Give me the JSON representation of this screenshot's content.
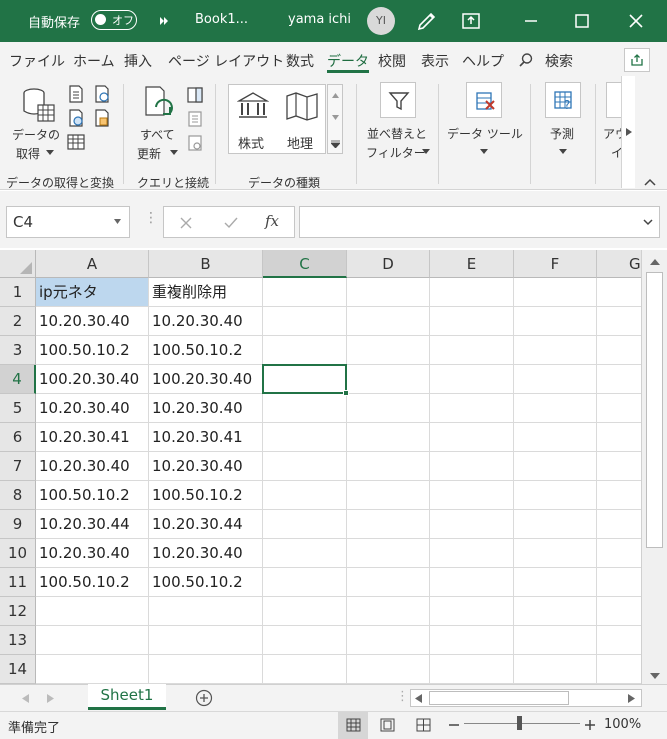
{
  "titlebar": {
    "autosave_label": "自動保存",
    "autosave_state": "オフ",
    "workbook": "Book1...",
    "user_name": "yama ichi",
    "user_initials": "YI"
  },
  "tabs": [
    "ファイル",
    "ホーム",
    "挿入",
    "ページ レイアウト",
    "数式",
    "データ",
    "校閲",
    "表示",
    "ヘルプ",
    "検索"
  ],
  "active_tab": "データ",
  "ribbon": {
    "get_data_line1": "データの",
    "get_data_line2": "取得",
    "refresh_line1": "すべて",
    "refresh_line2": "更新",
    "stocks": "株式",
    "geography": "地理",
    "sort_line1": "並べ替えと",
    "sort_line2": "フィルター",
    "data_tools": "データ ツール",
    "forecast": "予測",
    "outline_line1": "アウ",
    "outline_line2": "イ",
    "group_get_transform": "データの取得と変換",
    "group_queries": "クエリと接続",
    "group_data_types": "データの種類"
  },
  "formula_bar": {
    "name_box": "C4",
    "fx": "fx",
    "formula": ""
  },
  "grid": {
    "columns": [
      "A",
      "B",
      "C",
      "D",
      "E",
      "F",
      "G"
    ],
    "rows": [
      "1",
      "2",
      "3",
      "4",
      "5",
      "6",
      "7",
      "8",
      "9",
      "10",
      "11",
      "12",
      "13",
      "14"
    ],
    "col_a": [
      "ip元ネタ",
      "10.20.30.40",
      "100.50.10.2",
      "100.20.30.40",
      "10.20.30.40",
      "10.20.30.41",
      "10.20.30.40",
      "100.50.10.2",
      "10.20.30.44",
      "10.20.30.40",
      "100.50.10.2"
    ],
    "col_b": [
      "重複削除用",
      "10.20.30.40",
      "100.50.10.2",
      "100.20.30.40",
      "10.20.30.40",
      "10.20.30.41",
      "10.20.30.40",
      "100.50.10.2",
      "10.20.30.44",
      "10.20.30.40",
      "100.50.10.2"
    ],
    "active_cell": "C4"
  },
  "sheet_tab": "Sheet1",
  "status": {
    "ready": "準備完了",
    "zoom": "100%"
  },
  "colors": {
    "accent": "#217346",
    "header_highlight": "#bdd7ee"
  }
}
